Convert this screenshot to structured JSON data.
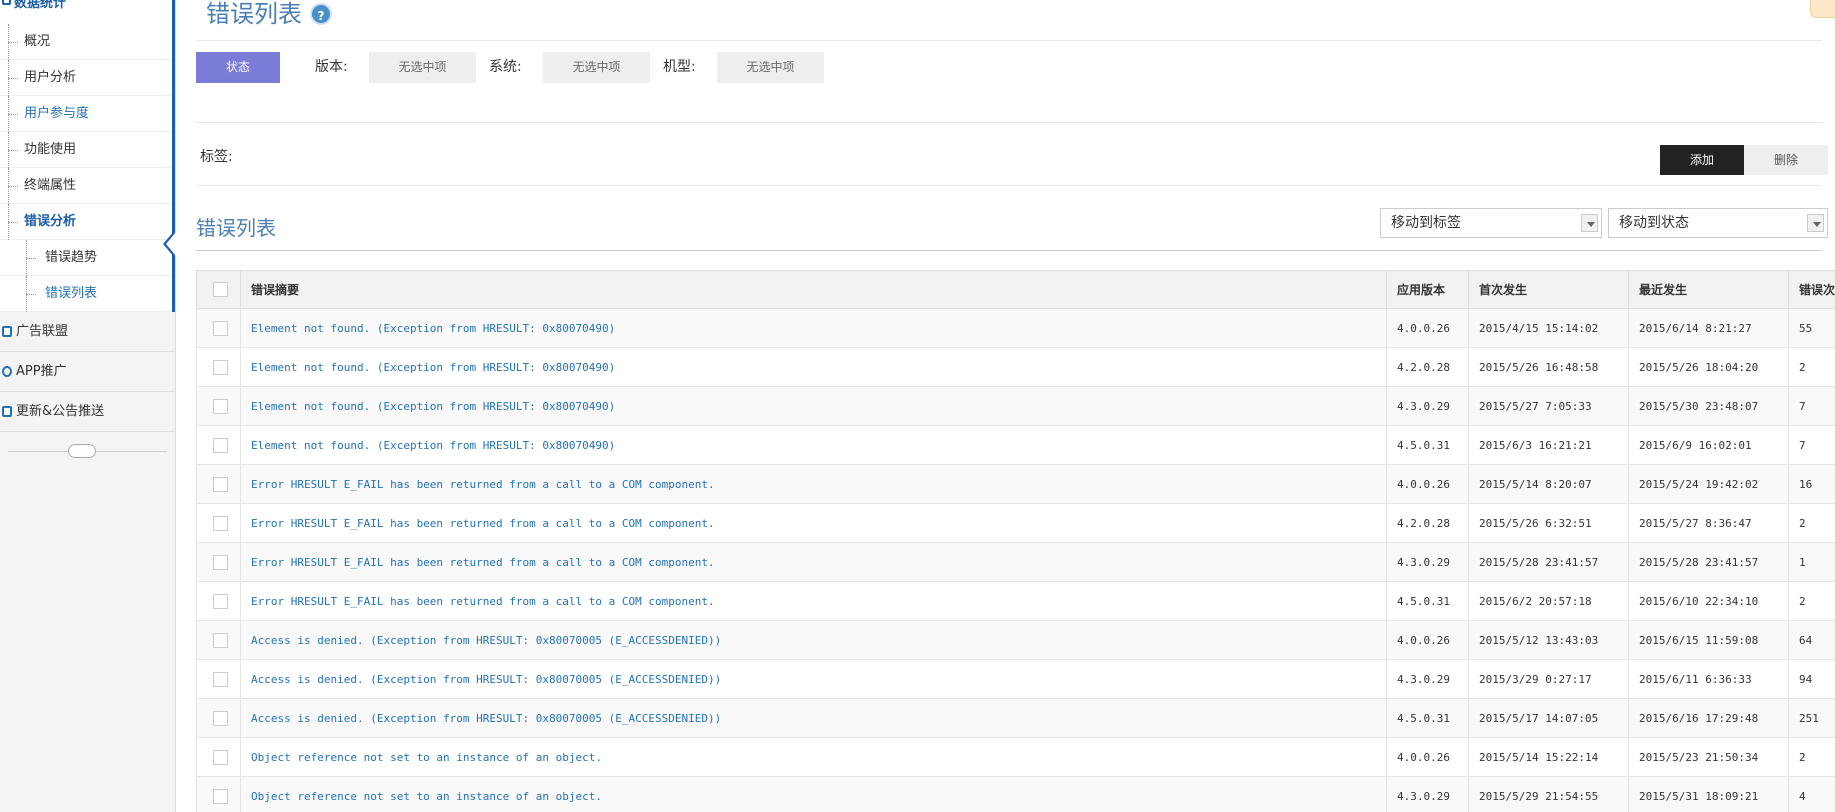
{
  "sidebar": {
    "section_title": "数据统计",
    "items": [
      {
        "label": "概况"
      },
      {
        "label": "用户分析"
      },
      {
        "label": "用户参与度"
      },
      {
        "label": "功能使用"
      },
      {
        "label": "终端属性"
      },
      {
        "label": "错误分析"
      },
      {
        "label": "错误趋势"
      },
      {
        "label": "错误列表"
      }
    ],
    "main_items": [
      {
        "label": "广告联盟"
      },
      {
        "label": "APP推广"
      },
      {
        "label": "更新&公告推送"
      }
    ]
  },
  "header": {
    "title": "错误列表",
    "help": "?"
  },
  "filters": {
    "state_button": "状态",
    "version_label": "版本:",
    "version_value": "无选中项",
    "system_label": "系统:",
    "system_value": "无选中项",
    "model_label": "机型:",
    "model_value": "无选中项"
  },
  "tags": {
    "label": "标签:",
    "add": "添加",
    "delete": "删除"
  },
  "list": {
    "title": "错误列表",
    "move_to_tag": "移动到标签",
    "move_to_state": "移动到状态",
    "columns": [
      "错误摘要",
      "应用版本",
      "首次发生",
      "最近发生",
      "错误次数"
    ],
    "rows": [
      {
        "msg": "Element not found. (Exception from HRESULT: 0x80070490)",
        "ver": "4.0.0.26",
        "first": "2015/4/15 15:14:02",
        "last": "2015/6/14 8:21:27",
        "count": "55"
      },
      {
        "msg": "Element not found. (Exception from HRESULT: 0x80070490)",
        "ver": "4.2.0.28",
        "first": "2015/5/26 16:48:58",
        "last": "2015/5/26 18:04:20",
        "count": "2"
      },
      {
        "msg": "Element not found. (Exception from HRESULT: 0x80070490)",
        "ver": "4.3.0.29",
        "first": "2015/5/27 7:05:33",
        "last": "2015/5/30 23:48:07",
        "count": "7"
      },
      {
        "msg": "Element not found. (Exception from HRESULT: 0x80070490)",
        "ver": "4.5.0.31",
        "first": "2015/6/3 16:21:21",
        "last": "2015/6/9 16:02:01",
        "count": "7"
      },
      {
        "msg": "Error HRESULT E_FAIL has been returned from a call to a COM component.",
        "ver": "4.0.0.26",
        "first": "2015/5/14 8:20:07",
        "last": "2015/5/24 19:42:02",
        "count": "16"
      },
      {
        "msg": "Error HRESULT E_FAIL has been returned from a call to a COM component.",
        "ver": "4.2.0.28",
        "first": "2015/5/26 6:32:51",
        "last": "2015/5/27 8:36:47",
        "count": "2"
      },
      {
        "msg": "Error HRESULT E_FAIL has been returned from a call to a COM component.",
        "ver": "4.3.0.29",
        "first": "2015/5/28 23:41:57",
        "last": "2015/5/28 23:41:57",
        "count": "1"
      },
      {
        "msg": "Error HRESULT E_FAIL has been returned from a call to a COM component.",
        "ver": "4.5.0.31",
        "first": "2015/6/2 20:57:18",
        "last": "2015/6/10 22:34:10",
        "count": "2"
      },
      {
        "msg": "Access is denied. (Exception from HRESULT: 0x80070005 (E_ACCESSDENIED))",
        "ver": "4.0.0.26",
        "first": "2015/5/12 13:43:03",
        "last": "2015/6/15 11:59:08",
        "count": "64"
      },
      {
        "msg": "Access is denied. (Exception from HRESULT: 0x80070005 (E_ACCESSDENIED))",
        "ver": "4.3.0.29",
        "first": "2015/3/29 0:27:17",
        "last": "2015/6/11 6:36:33",
        "count": "94"
      },
      {
        "msg": "Access is denied. (Exception from HRESULT: 0x80070005 (E_ACCESSDENIED))",
        "ver": "4.5.0.31",
        "first": "2015/5/17 14:07:05",
        "last": "2015/6/16 17:29:48",
        "count": "251"
      },
      {
        "msg": "Object reference not set to an instance of an object.",
        "ver": "4.0.0.26",
        "first": "2015/5/14 15:22:14",
        "last": "2015/5/23 21:50:34",
        "count": "2"
      },
      {
        "msg": "Object reference not set to an instance of an object.",
        "ver": "4.3.0.29",
        "first": "2015/5/29 21:54:55",
        "last": "2015/5/31 18:09:21",
        "count": "4"
      }
    ]
  }
}
